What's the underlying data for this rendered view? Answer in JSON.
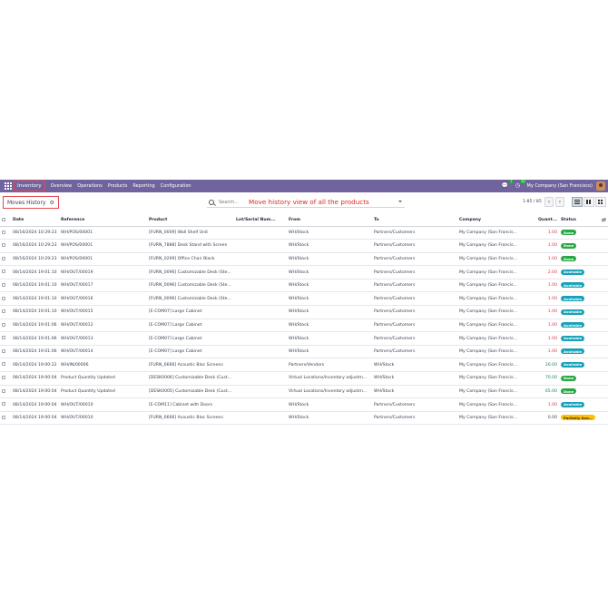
{
  "navbar": {
    "app_name": "Inventory",
    "menu": [
      "Overview",
      "Operations",
      "Products",
      "Reporting",
      "Configuration"
    ],
    "chat_badge": "7",
    "activity_badge": "10",
    "company": "My Company (San Francisco)"
  },
  "control": {
    "breadcrumb": "Moves History",
    "search_placeholder": "Search...",
    "annotation": "Move history view of all the products",
    "pager": "1-85 / 85"
  },
  "table": {
    "headers": [
      "Date",
      "Reference",
      "Product",
      "Lot/Serial Num...",
      "From",
      "To",
      "Company",
      "Quant...",
      "Status"
    ],
    "rows": [
      {
        "date": "08/16/2024 10:29:23",
        "ref": "WH/POS/00001",
        "product": "[FURN_0009] Wall Shelf Unit",
        "lot": "",
        "from": "WH/Stock",
        "to": "Partners/Customers",
        "company": "My Company (San Francis...",
        "qty": "1.00",
        "qty_type": "out",
        "status": "Done",
        "status_type": "done"
      },
      {
        "date": "08/16/2024 10:29:23",
        "ref": "WH/POS/00001",
        "product": "[FURN_7888] Desk Stand with Screen",
        "lot": "",
        "from": "WH/Stock",
        "to": "Partners/Customers",
        "company": "My Company (San Francis...",
        "qty": "1.00",
        "qty_type": "out",
        "status": "Done",
        "status_type": "done"
      },
      {
        "date": "08/16/2024 10:29:23",
        "ref": "WH/POS/00001",
        "product": "[FURN_0269] Office Chair Black",
        "lot": "",
        "from": "WH/Stock",
        "to": "Partners/Customers",
        "company": "My Company (San Francis...",
        "qty": "1.00",
        "qty_type": "out",
        "status": "Done",
        "status_type": "done"
      },
      {
        "date": "08/14/2024 19:01:10",
        "ref": "WH/OUT/00019",
        "product": "[FURN_0096] Customizable Desk (Ste...",
        "lot": "",
        "from": "WH/Stock",
        "to": "Partners/Customers",
        "company": "My Company (San Francis...",
        "qty": "2.00",
        "qty_type": "out",
        "status": "Available",
        "status_type": "available"
      },
      {
        "date": "08/14/2024 19:01:10",
        "ref": "WH/OUT/00017",
        "product": "[FURN_0096] Customizable Desk (Ste...",
        "lot": "",
        "from": "WH/Stock",
        "to": "Partners/Customers",
        "company": "My Company (San Francis...",
        "qty": "1.00",
        "qty_type": "out",
        "status": "Available",
        "status_type": "available"
      },
      {
        "date": "08/14/2024 19:01:10",
        "ref": "WH/OUT/00016",
        "product": "[FURN_0096] Customizable Desk (Ste...",
        "lot": "",
        "from": "WH/Stock",
        "to": "Partners/Customers",
        "company": "My Company (San Francis...",
        "qty": "1.00",
        "qty_type": "out",
        "status": "Available",
        "status_type": "available"
      },
      {
        "date": "08/14/2024 19:01:10",
        "ref": "WH/OUT/00015",
        "product": "[E-COM07] Large Cabinet",
        "lot": "",
        "from": "WH/Stock",
        "to": "Partners/Customers",
        "company": "My Company (San Francis...",
        "qty": "1.00",
        "qty_type": "out",
        "status": "Available",
        "status_type": "available"
      },
      {
        "date": "08/14/2024 19:01:06",
        "ref": "WH/OUT/00012",
        "product": "[E-COM07] Large Cabinet",
        "lot": "",
        "from": "WH/Stock",
        "to": "Partners/Customers",
        "company": "My Company (San Francis...",
        "qty": "1.00",
        "qty_type": "out",
        "status": "Available",
        "status_type": "available"
      },
      {
        "date": "08/14/2024 19:01:06",
        "ref": "WH/OUT/00013",
        "product": "[E-COM07] Large Cabinet",
        "lot": "",
        "from": "WH/Stock",
        "to": "Partners/Customers",
        "company": "My Company (San Francis...",
        "qty": "1.00",
        "qty_type": "out",
        "status": "Available",
        "status_type": "available"
      },
      {
        "date": "08/14/2024 19:01:06",
        "ref": "WH/OUT/00014",
        "product": "[E-COM07] Large Cabinet",
        "lot": "",
        "from": "WH/Stock",
        "to": "Partners/Customers",
        "company": "My Company (San Francis...",
        "qty": "1.00",
        "qty_type": "out",
        "status": "Available",
        "status_type": "available"
      },
      {
        "date": "08/14/2024 19:00:22",
        "ref": "WH/IN/00006",
        "product": "[FURN_6666] Acoustic Bloc Screens",
        "lot": "",
        "from": "Partners/Vendors",
        "to": "WH/Stock",
        "company": "My Company (San Francis...",
        "qty": "20.00",
        "qty_type": "in",
        "status": "Available",
        "status_type": "available"
      },
      {
        "date": "08/14/2024 19:00:04",
        "ref": "Product Quantity Updated",
        "product": "[DESK0006] Customizable Desk (Cust...",
        "lot": "",
        "from": "Virtual Locations/Inventory adjustm...",
        "to": "WH/Stock",
        "company": "My Company (San Francis...",
        "qty": "70.00",
        "qty_type": "in",
        "status": "Done",
        "status_type": "done"
      },
      {
        "date": "08/14/2024 19:00:04",
        "ref": "Product Quantity Updated",
        "product": "[DESK0005] Customizable Desk (Cust...",
        "lot": "",
        "from": "Virtual Locations/Inventory adjustm...",
        "to": "WH/Stock",
        "company": "My Company (San Francis...",
        "qty": "65.00",
        "qty_type": "in",
        "status": "Done",
        "status_type": "done"
      },
      {
        "date": "08/14/2024 19:00:04",
        "ref": "WH/OUT/00010",
        "product": "[E-COM11] Cabinet with Doors",
        "lot": "",
        "from": "WH/Stock",
        "to": "Partners/Customers",
        "company": "My Company (San Francis...",
        "qty": "1.00",
        "qty_type": "out",
        "status": "Available",
        "status_type": "available"
      },
      {
        "date": "08/14/2024 19:00:04",
        "ref": "WH/OUT/00010",
        "product": "[FURN_6666] Acoustic Bloc Screens",
        "lot": "",
        "from": "WH/Stock",
        "to": "Partners/Customers",
        "company": "My Company (San Francis...",
        "qty": "0.00",
        "qty_type": "neutral",
        "status": "Partially Availa...",
        "status_type": "partial"
      }
    ]
  }
}
